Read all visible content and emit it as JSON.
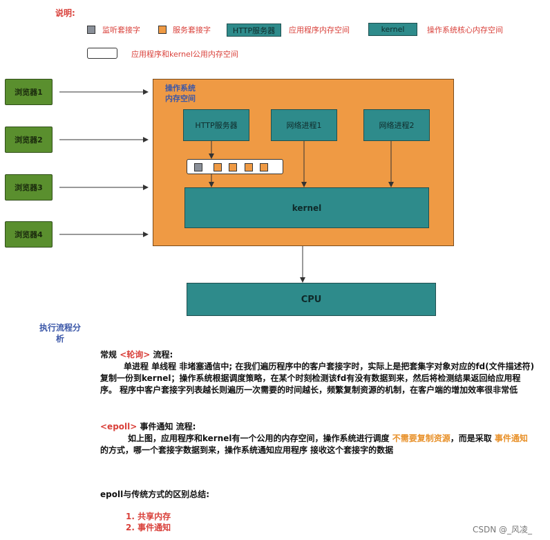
{
  "legend": {
    "title": "说明:",
    "listen_socket": "监听套接字",
    "service_socket": "服务套接字",
    "http_server_box": "HTTP服务器",
    "app_memory": "应用程序内存空间",
    "kernel_box": "kernel",
    "os_core_memory": "操作系统核心内存空间",
    "shared_memory": "应用程序和kernel公用内存空间"
  },
  "browsers": [
    "浏览器1",
    "浏览器2",
    "浏览器3",
    "浏览器4"
  ],
  "os": {
    "label_line1": "操作系统",
    "label_line2": "内存空间",
    "http_server": "HTTP服务器",
    "process1": "网络进程1",
    "process2": "网络进程2",
    "kernel": "kernel"
  },
  "cpu": "CPU",
  "exec_title": "执行流程分析",
  "text": {
    "p1_prefix": "常规 ",
    "p1_tag": "<轮询>",
    "p1_suffix": " 流程:",
    "p1_body": "单进程 单线程 非堵塞通信中; 在我们遍历程序中的客户套接字时，实际上是把套集字对象对应的fd(文件描述符) 复制一份到kernel；操作系统根据调度策略，在某个时刻检测该fd有没有数据到来，然后将检测结果返回给应用程序。 程序中客户套接字列表越长则遍历一次需要的时间越长，频繁复制资源的机制，在客户端的增加效率很非常低",
    "p2_tag": "<epoll>",
    "p2_suffix": " 事件通知 流程:",
    "p2_body_a": "如上图，应用程序和kernel有一个公用的内存空间，操作系统进行调度 ",
    "p2_hl1": "不需要复制资源",
    "p2_body_b": "，而是采取 ",
    "p2_hl2": "事件通知",
    "p2_body_c": " 的方式，哪一个套接字数据到来，操作系统通知应用程序 接收这个套接字的数据",
    "summary_title": "epoll与传统方式的区别总结:",
    "item1": "1. 共享内存",
    "item2": "2. 事件通知"
  },
  "watermark": "CSDN @_风凌_",
  "colors": {
    "orange": "#ef9a44",
    "teal": "#2e8b8b",
    "green": "#5a8f2e",
    "grey": "#8a9099",
    "red_text": "#d9403a",
    "blue_text": "#3b57a8"
  }
}
